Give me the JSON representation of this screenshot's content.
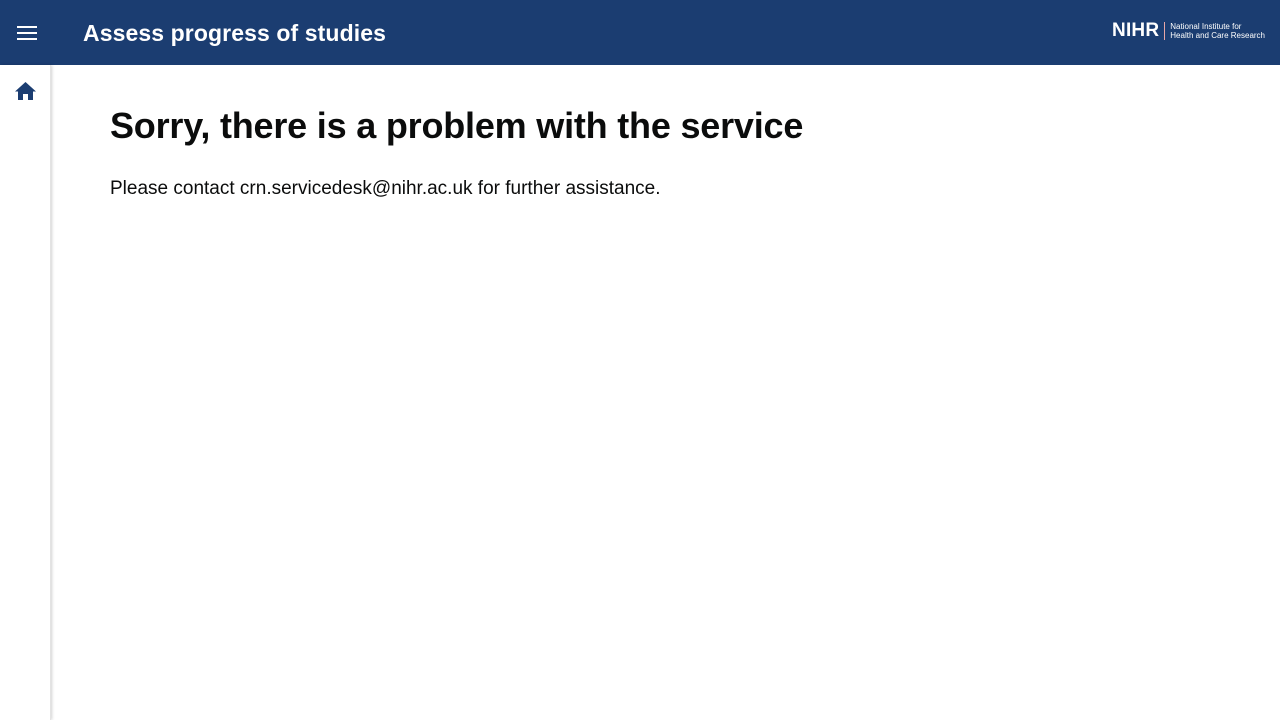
{
  "header": {
    "title": "Assess progress of studies",
    "menu_icon": "hamburger-menu-icon",
    "background_color": "#1b3d71"
  },
  "logo": {
    "mark": "NIHR",
    "line1": "National Institute for",
    "line2": "Health and Care Research"
  },
  "sidebar": {
    "home_icon": "home-icon"
  },
  "main": {
    "heading": "Sorry, there is a problem with the service",
    "message_prefix": "Please contact ",
    "email": "crn.servicedesk@nihr.ac.uk",
    "message_suffix": " for further assistance."
  }
}
